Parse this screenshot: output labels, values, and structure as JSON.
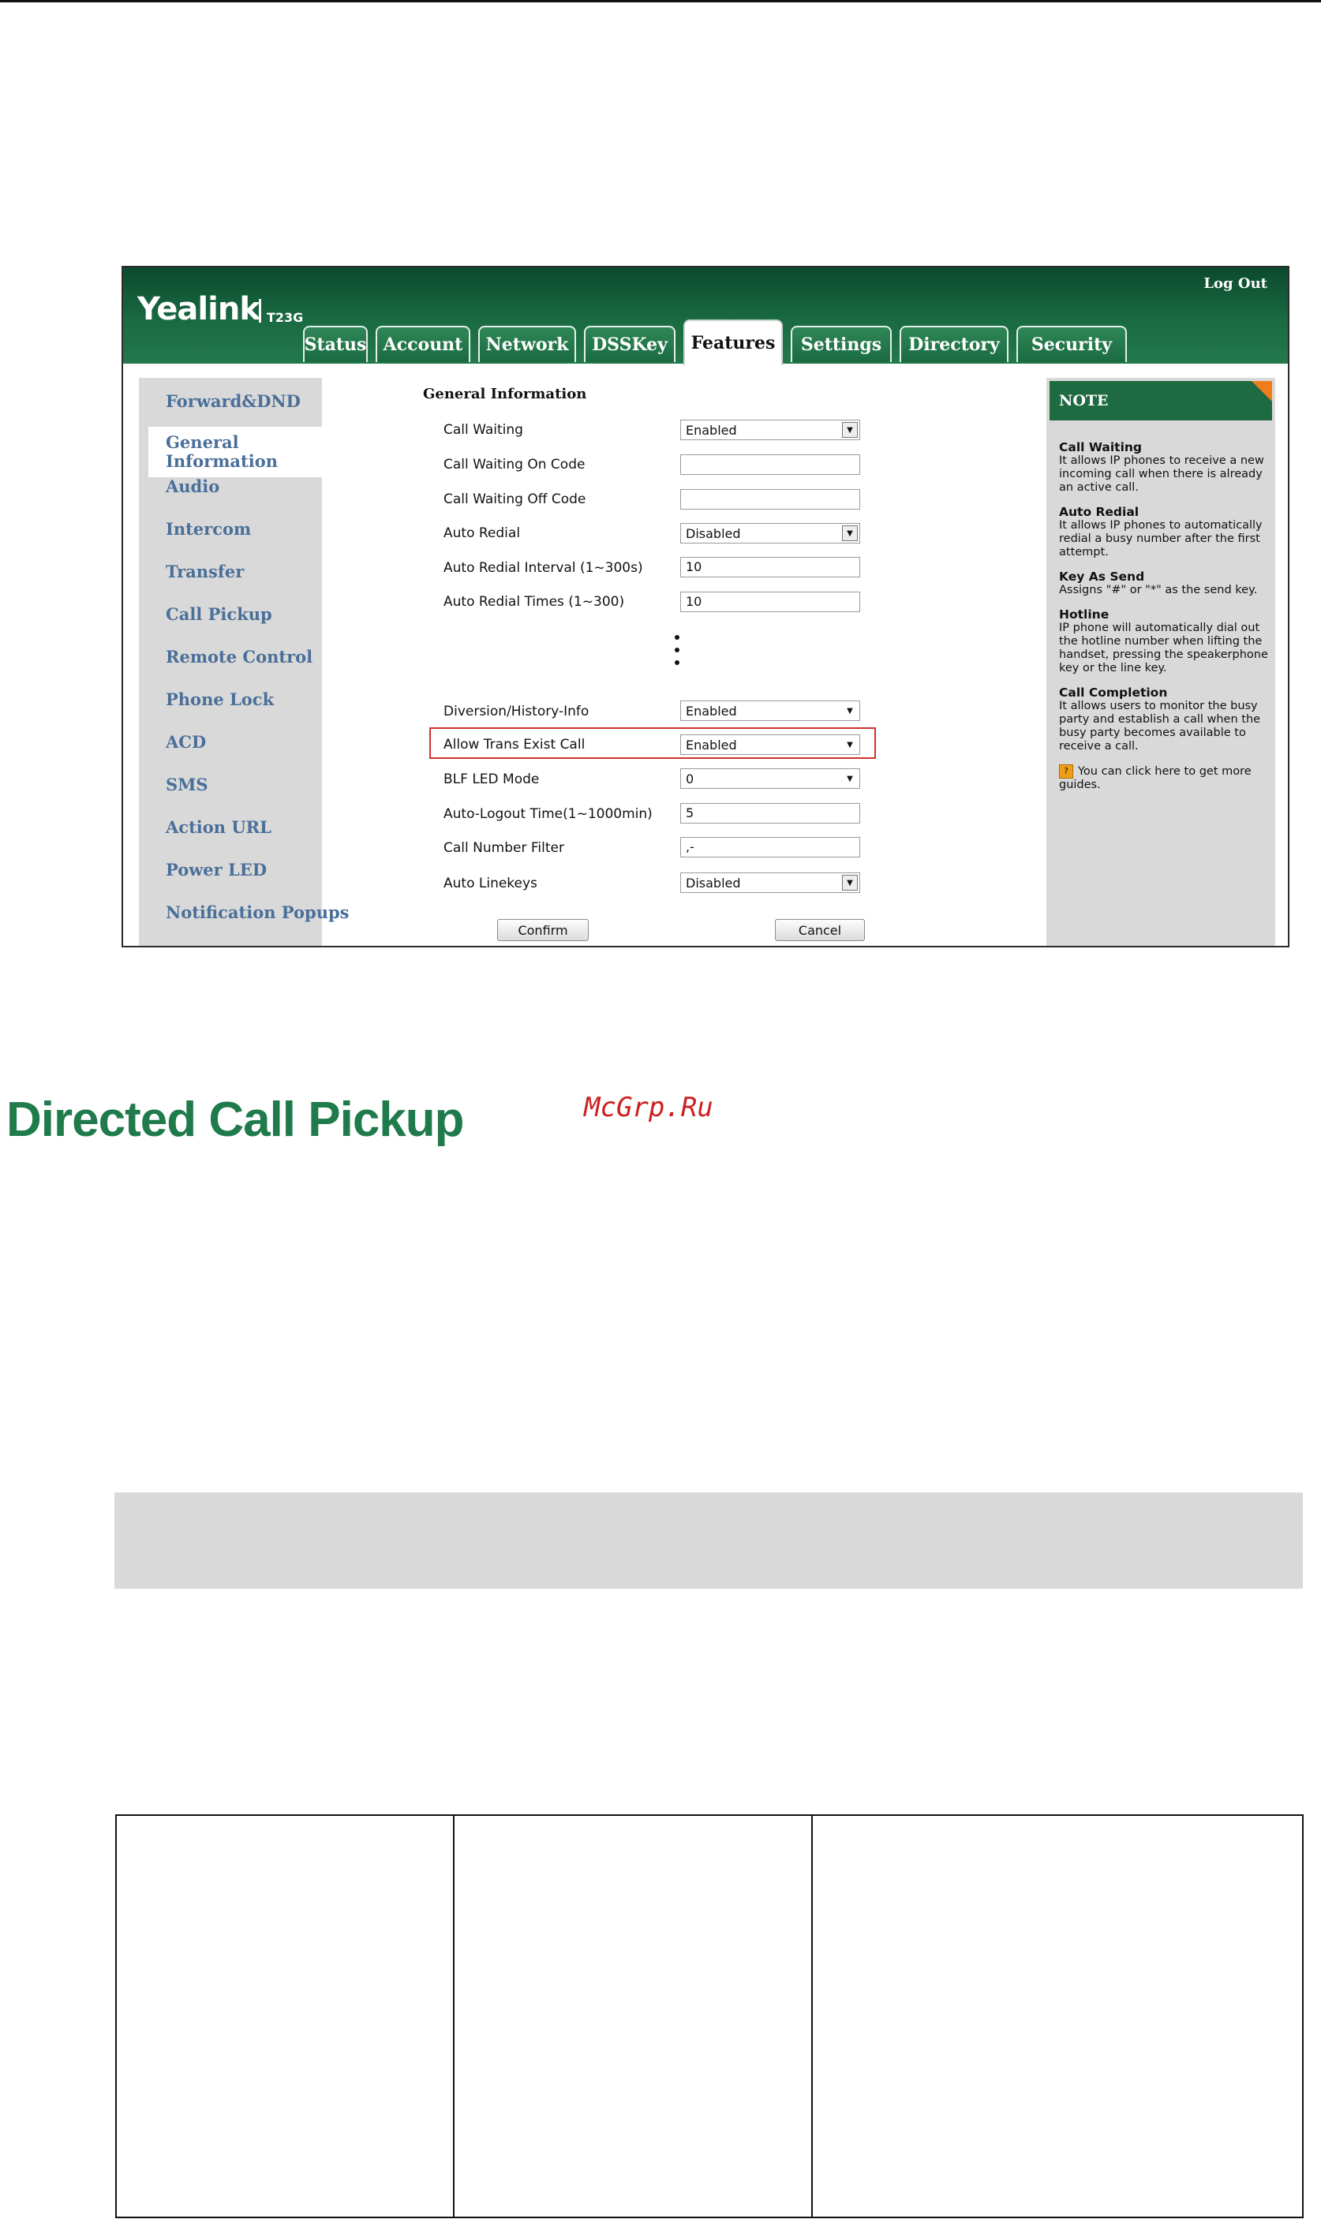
{
  "brand": {
    "logo": "Yealink",
    "model": "T23G"
  },
  "header": {
    "logout_label": "Log Out"
  },
  "tabs": [
    {
      "label": "Status"
    },
    {
      "label": "Account"
    },
    {
      "label": "Network"
    },
    {
      "label": "DSSKey"
    },
    {
      "label": "Features",
      "active": true
    },
    {
      "label": "Settings"
    },
    {
      "label": "Directory"
    },
    {
      "label": "Security"
    }
  ],
  "sidebar": {
    "items": [
      {
        "label": "Forward&DND"
      },
      {
        "label": "General Information",
        "active": true
      },
      {
        "label": "Audio"
      },
      {
        "label": "Intercom"
      },
      {
        "label": "Transfer"
      },
      {
        "label": "Call Pickup"
      },
      {
        "label": "Remote Control"
      },
      {
        "label": "Phone Lock"
      },
      {
        "label": "ACD"
      },
      {
        "label": "SMS"
      },
      {
        "label": "Action URL"
      },
      {
        "label": "Power LED"
      },
      {
        "label": "Notification Popups"
      }
    ]
  },
  "form": {
    "title": "General Information",
    "rows": [
      {
        "label": "Call Waiting",
        "value": "Enabled",
        "type": "select"
      },
      {
        "label": "Call Waiting On Code",
        "value": "",
        "type": "text"
      },
      {
        "label": "Call Waiting Off Code",
        "value": "",
        "type": "text"
      },
      {
        "label": "Auto Redial",
        "value": "Disabled",
        "type": "select"
      },
      {
        "label": "Auto Redial Interval (1~300s)",
        "value": "10",
        "type": "text"
      },
      {
        "label": "Auto Redial Times (1~300)",
        "value": "10",
        "type": "text"
      },
      {
        "label": "Diversion/History-Info",
        "value": "Enabled",
        "type": "select"
      },
      {
        "label": "Allow Trans Exist Call",
        "value": "Enabled",
        "type": "select",
        "highlighted": true
      },
      {
        "label": "BLF LED Mode",
        "value": "0",
        "type": "select"
      },
      {
        "label": "Auto-Logout Time(1~1000min)",
        "value": "5",
        "type": "text"
      },
      {
        "label": "Call Number Filter",
        "value": ",-",
        "type": "text"
      },
      {
        "label": "Auto Linekeys",
        "value": "Disabled",
        "type": "select"
      }
    ],
    "confirm_label": "Confirm",
    "cancel_label": "Cancel"
  },
  "note": {
    "title": "NOTE",
    "sections": [
      {
        "heading": "Call Waiting",
        "text": "It allows IP phones to receive a new incoming call when there is already an active call."
      },
      {
        "heading": "Auto Redial",
        "text": "It allows IP phones to automatically redial a busy number after the first attempt."
      },
      {
        "heading": "Key As Send",
        "text": "Assigns \"#\" or \"*\" as the send key."
      },
      {
        "heading": "Hotline",
        "text": "IP phone will automatically dial out the hotline number when lifting the handset, pressing the speakerphone key or the line key."
      },
      {
        "heading": "Call Completion",
        "text": "It allows users to monitor the busy party and establish a call when the busy party becomes available to receive a call."
      }
    ],
    "guide_text": "You can click here to get more guides.",
    "guide_icon": "help-icon"
  },
  "document": {
    "heading": "Directed Call Pickup",
    "watermark": "McGrp.Ru"
  },
  "colors": {
    "header_green": "#1a6a42",
    "heading_green": "#1f7a4c",
    "sidebar_link": "#4a6f99",
    "highlight_red": "#d0312d",
    "note_corner": "#ef7d1a",
    "watermark_red": "#cc1f1f"
  }
}
